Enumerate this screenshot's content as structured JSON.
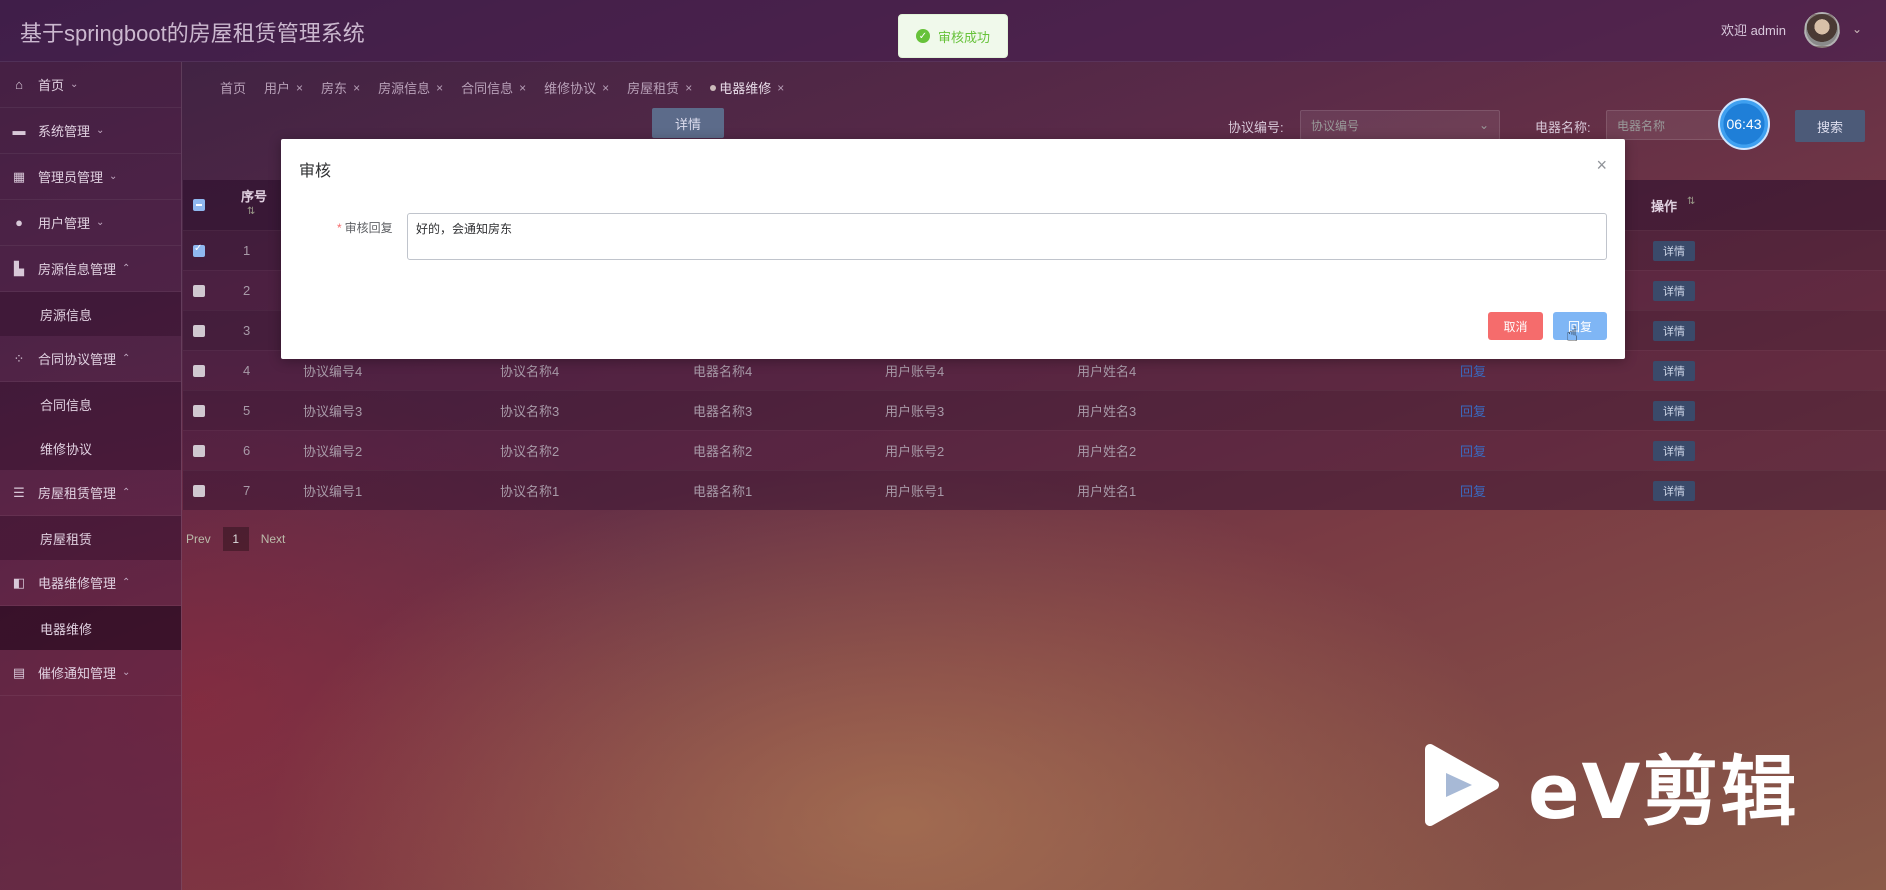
{
  "app": {
    "title": "基于springboot的房屋租赁管理系统",
    "welcome": "欢迎 admin"
  },
  "toast": {
    "message": "审核成功"
  },
  "sidebar": {
    "items": [
      {
        "label": "首页",
        "icon": "home-icon",
        "expanded": false
      },
      {
        "label": "系统管理",
        "icon": "system-icon",
        "expanded": false
      },
      {
        "label": "管理员管理",
        "icon": "grid-icon",
        "expanded": false
      },
      {
        "label": "用户管理",
        "icon": "user-icon",
        "expanded": false
      },
      {
        "label": "房源信息管理",
        "icon": "building-icon",
        "expanded": true,
        "children": [
          "房源信息"
        ]
      },
      {
        "label": "合同协议管理",
        "icon": "apps-icon",
        "expanded": true,
        "children": [
          "合同信息",
          "维修协议"
        ]
      },
      {
        "label": "房屋租赁管理",
        "icon": "stack-icon",
        "expanded": true,
        "children": [
          "房屋租赁"
        ]
      },
      {
        "label": "电器维修管理",
        "icon": "module-icon",
        "expanded": true,
        "children": [
          "电器维修"
        ]
      },
      {
        "label": "催修通知管理",
        "icon": "box-icon",
        "expanded": false
      }
    ]
  },
  "tabs": [
    "首页",
    "用户",
    "房东",
    "房源信息",
    "合同信息",
    "维修协议",
    "房屋租赁",
    "电器维修"
  ],
  "active_tab": "电器维修",
  "toolbar": {
    "detail_label": "详情",
    "agreement_no_label": "协议编号:",
    "agreement_no_placeholder": "协议编号",
    "appliance_name_label": "电器名称:",
    "appliance_name_placeholder": "电器名称",
    "search_label": "搜索",
    "timer": "06:43"
  },
  "table": {
    "headers": {
      "index": "序号",
      "op": "操作"
    },
    "rows": [
      {
        "index": "1",
        "checked": true,
        "agreement_no": "",
        "agreement_name": "",
        "appliance": "",
        "account": "",
        "username": "",
        "reply": "",
        "detail": "详情"
      },
      {
        "index": "2",
        "checked": false,
        "agreement_no": "",
        "agreement_name": "",
        "appliance": "",
        "account": "",
        "username": "",
        "reply": "",
        "detail": "详情"
      },
      {
        "index": "3",
        "checked": false,
        "agreement_no": "",
        "agreement_name": "",
        "appliance": "",
        "account": "",
        "username": "",
        "reply": "",
        "detail": "详情"
      },
      {
        "index": "4",
        "checked": false,
        "agreement_no": "协议编号4",
        "agreement_name": "协议名称4",
        "appliance": "电器名称4",
        "account": "用户账号4",
        "username": "用户姓名4",
        "reply": "回复",
        "detail": "详情"
      },
      {
        "index": "5",
        "checked": false,
        "agreement_no": "协议编号3",
        "agreement_name": "协议名称3",
        "appliance": "电器名称3",
        "account": "用户账号3",
        "username": "用户姓名3",
        "reply": "回复",
        "detail": "详情"
      },
      {
        "index": "6",
        "checked": false,
        "agreement_no": "协议编号2",
        "agreement_name": "协议名称2",
        "appliance": "电器名称2",
        "account": "用户账号2",
        "username": "用户姓名2",
        "reply": "回复",
        "detail": "详情"
      },
      {
        "index": "7",
        "checked": false,
        "agreement_no": "协议编号1",
        "agreement_name": "协议名称1",
        "appliance": "电器名称1",
        "account": "用户账号1",
        "username": "用户姓名1",
        "reply": "回复",
        "detail": "详情"
      }
    ]
  },
  "pager": {
    "prev": "Prev",
    "page": "1",
    "next": "Next"
  },
  "dialog": {
    "title": "审核",
    "field_label": "审核回复",
    "field_value": "好的，会通知房东",
    "cancel": "取消",
    "reply": "回复"
  },
  "watermark": {
    "text": "eV剪辑"
  }
}
